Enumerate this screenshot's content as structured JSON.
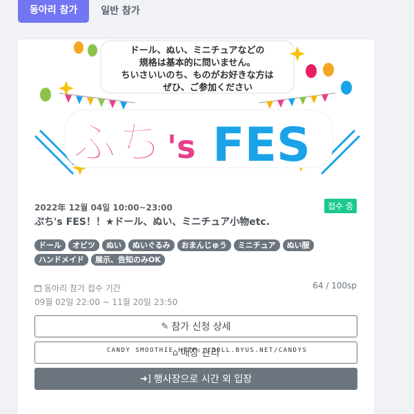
{
  "tabs": [
    {
      "label": "동아리 참가",
      "active": true
    },
    {
      "label": "일반 참가",
      "active": false
    }
  ],
  "banner": {
    "line1": "ドール、ぬい、ミニチュアなどの",
    "line2": "規格は基本的に問いません。",
    "line3": "ちいさいいのち、ものがお好きな方は",
    "line4": "ぜひ、ご参加ください",
    "logo_part1": "ぷち",
    "logo_part2": "'s",
    "logo_part3": "FES"
  },
  "event": {
    "date": "2022年 12월 04일 10:00~23:00",
    "status": "접수 중",
    "title": "ぷち's FES！！★ドール、ぬい、ミニチュア小物etc.",
    "tags": [
      "ドール",
      "オビツ",
      "ぬい",
      "ぬいぐるみ",
      "おまんじゅう",
      "ミニチュア",
      "ぬい服",
      "ハンドメイド",
      "展示、告知のみOK"
    ],
    "period_label": "동아리 참가 접수 기간",
    "period_value": "09월 02일 22:00 ~ 11월 20일 23:50",
    "capacity": "64 / 100sp"
  },
  "buttons": {
    "apply_detail": "참가 신청 상세",
    "booth_manage": "매장 관리",
    "enter_off_hours": "행사장으로 시간 외 입장"
  },
  "watermark": "CANDY SMOOTHIE HTTP://DOLL.BYUS.NET/CANDYS",
  "colors": {
    "accent": "#7276f2",
    "status": "#1bc98e",
    "tag": "#6c757d",
    "logo_pink": "#e83e8c",
    "logo_blue": "#1aa3e8",
    "logo_yellow": "#f6b40e"
  }
}
